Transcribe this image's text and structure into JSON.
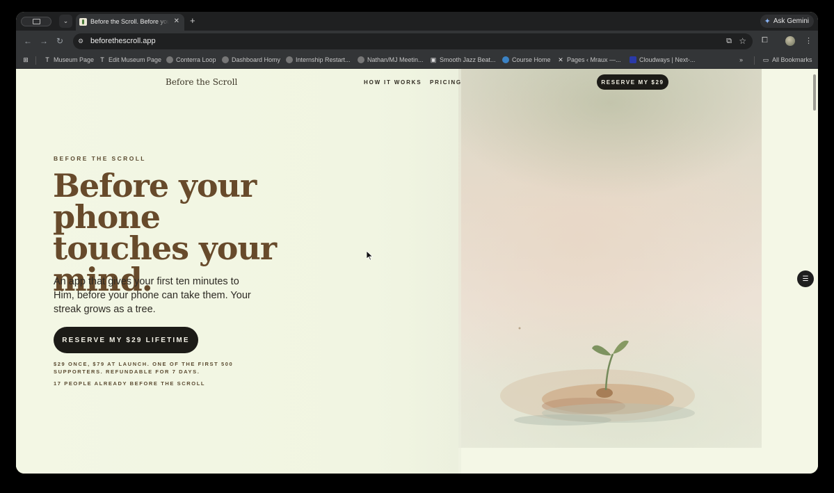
{
  "browser": {
    "tab": {
      "title": "Before the Scroll. Before your phone touches your mind."
    },
    "new_tab_icon": "+",
    "ask_gemini": "Ask Gemini",
    "url": "beforethescroll.app",
    "bookmarks": [
      {
        "label": "Museum Page",
        "icon": "T"
      },
      {
        "label": "Edit Museum Page",
        "icon": "T"
      },
      {
        "label": "Conterra Loop",
        "icon": "globe-icon"
      },
      {
        "label": "Dashboard Homy",
        "icon": "globe-icon"
      },
      {
        "label": "Internship Restart...",
        "icon": "globe-icon"
      },
      {
        "label": "Nathan/MJ Meetin...",
        "icon": "chrome-icon"
      },
      {
        "label": "Smooth Jazz Beat...",
        "icon": "app-icon"
      },
      {
        "label": "Course Home",
        "icon": "course-icon"
      },
      {
        "label": "Pages ‹ Mraux —...",
        "icon": "x-icon"
      },
      {
        "label": "Cloudways | Next-...",
        "icon": "cloudways-icon"
      }
    ],
    "all_bookmarks": "All Bookmarks"
  },
  "site": {
    "logo": "Before the Scroll",
    "nav": {
      "how_it_works": "HOW IT WORKS",
      "pricing": "PRICING",
      "cta": "RESERVE MY $29"
    },
    "hero": {
      "eyebrow": "BEFORE THE SCROLL",
      "headline": "Before your phone touches your mind.",
      "subhead": "An app that gives your first ten minutes to Him, before your phone can take them. Your streak grows as a tree.",
      "cta": "RESERVE MY $29 LIFETIME",
      "fineprint": "$29 ONCE, $79 AT LAUNCH. ONE OF THE FIRST 500 SUPPORTERS. REFUNDABLE FOR 7 DAYS.",
      "social_proof": "17 PEOPLE ALREADY BEFORE THE SCROLL"
    }
  },
  "colors": {
    "page_bg": "#f4f7e6",
    "headline": "#674a2b",
    "button_bg": "#1c1b17",
    "button_text": "#f3f1e6"
  }
}
